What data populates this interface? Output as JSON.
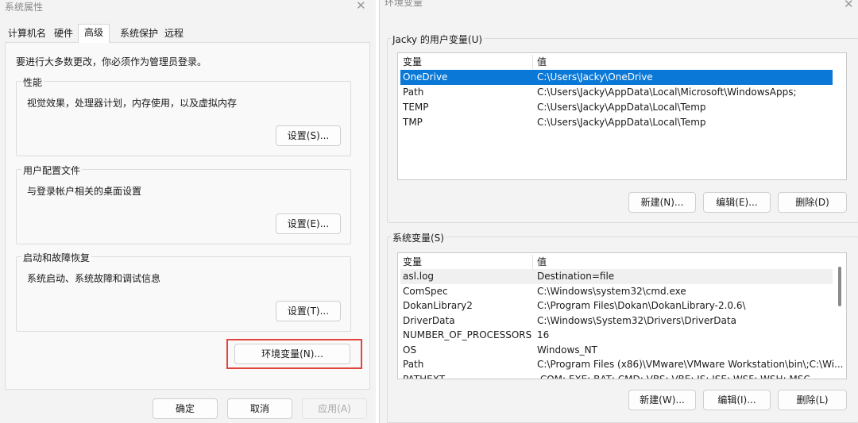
{
  "system_properties": {
    "title": "系统属性",
    "close_glyph": "✕",
    "tabs": [
      "计算机名",
      "硬件",
      "高级",
      "系统保护",
      "远程"
    ],
    "admin_note": "要进行大多数更改，你必须作为管理员登录。",
    "performance": {
      "label": "性能",
      "description": "视觉效果，处理器计划，内存使用，以及虚拟内存",
      "button": "设置(S)..."
    },
    "user_profiles": {
      "label": "用户配置文件",
      "description": "与登录帐户相关的桌面设置",
      "button": "设置(E)..."
    },
    "startup_recovery": {
      "label": "启动和故障恢复",
      "description": "系统启动、系统故障和调试信息",
      "button": "设置(T)..."
    },
    "env_vars_button": "环境变量(N)...",
    "footer": {
      "ok": "确定",
      "cancel": "取消",
      "apply": "应用(A)"
    }
  },
  "environment_variables": {
    "title": "环境变量",
    "close_glyph": "✕",
    "user_vars": {
      "label": "Jacky 的用户变量(U)",
      "columns": [
        "变量",
        "值"
      ],
      "rows": [
        [
          "OneDrive",
          "C:\\Users\\Jacky\\OneDrive"
        ],
        [
          "Path",
          "C:\\Users\\Jacky\\AppData\\Local\\Microsoft\\WindowsApps;"
        ],
        [
          "TEMP",
          "C:\\Users\\Jacky\\AppData\\Local\\Temp"
        ],
        [
          "TMP",
          "C:\\Users\\Jacky\\AppData\\Local\\Temp"
        ]
      ],
      "buttons": {
        "new": "新建(N)...",
        "edit": "编辑(E)...",
        "delete": "删除(D)"
      }
    },
    "system_vars": {
      "label": "系统变量(S)",
      "columns": [
        "变量",
        "值"
      ],
      "rows": [
        [
          "asl.log",
          "Destination=file"
        ],
        [
          "ComSpec",
          "C:\\Windows\\system32\\cmd.exe"
        ],
        [
          "DokanLibrary2",
          "C:\\Program Files\\Dokan\\DokanLibrary-2.0.6\\"
        ],
        [
          "DriverData",
          "C:\\Windows\\System32\\Drivers\\DriverData"
        ],
        [
          "NUMBER_OF_PROCESSORS",
          "16"
        ],
        [
          "OS",
          "Windows_NT"
        ],
        [
          "Path",
          "C:\\Program Files (x86)\\VMware\\VMware Workstation\\bin\\;C:\\Wi..."
        ],
        [
          "PATHEXT",
          ".COM;.EXE;.BAT;.CMD;.VBS;.VBE;.JS;.JSE;.WSF;.WSH;.MSC"
        ]
      ],
      "buttons": {
        "new": "新建(W)...",
        "edit": "编辑(I)...",
        "delete": "删除(L)"
      }
    }
  },
  "colors": {
    "selection": "#0a78d7",
    "highlight_box": "#e0453c",
    "dialog_bg": "#f3f3f3"
  }
}
